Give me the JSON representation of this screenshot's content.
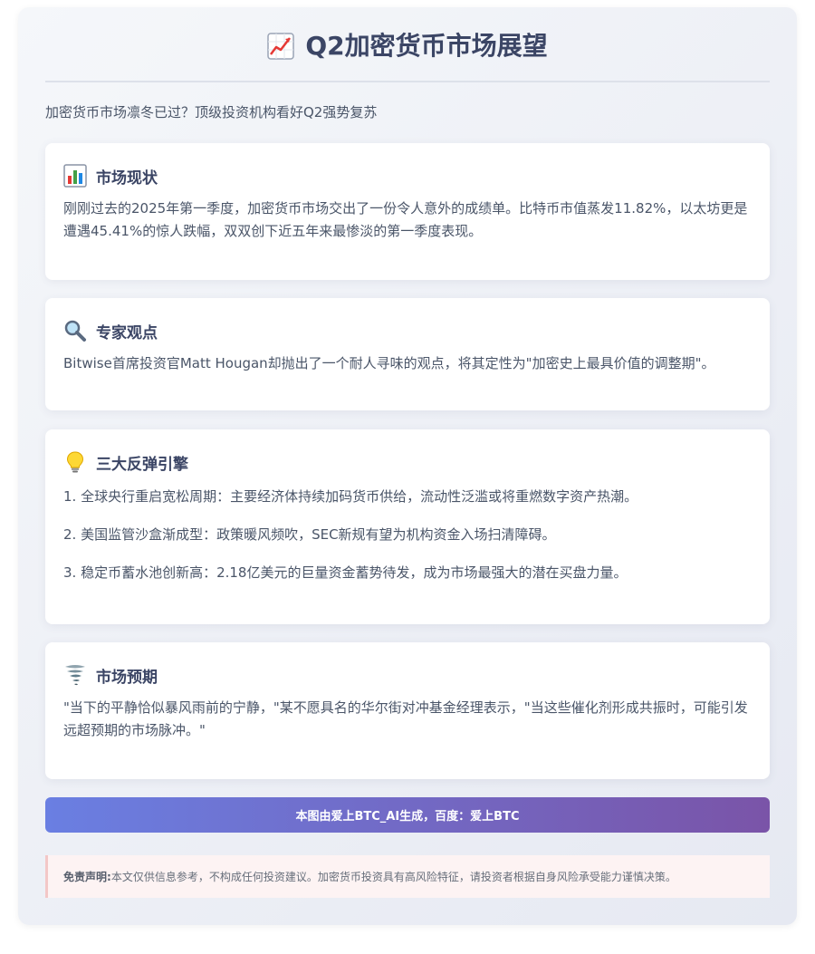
{
  "header": {
    "title": "Q2加密货币市场展望",
    "title_icon": "chart-up-icon"
  },
  "subtitle": "加密货币市场凛冬已过？顶级投资机构看好Q2强势复苏",
  "sections": [
    {
      "icon": "bar-chart-icon",
      "title": "市场现状",
      "text": "刚刚过去的2025年第一季度，加密货币市场交出了一份令人意外的成绩单。比特币市值蒸发11.82%，以太坊更是遭遇45.41%的惊人跌幅，双双创下近五年来最惨淡的第一季度表现。"
    },
    {
      "icon": "magnifier-icon",
      "title": "专家观点",
      "text": "Bitwise首席投资官Matt Hougan却抛出了一个耐人寻味的观点，将其定性为\"加密史上最具价值的调整期\"。"
    },
    {
      "icon": "lightbulb-icon",
      "title": "三大反弹引擎",
      "items": [
        "1. 全球央行重启宽松周期：主要经济体持续加码货币供给，流动性泛滥或将重燃数字资产热潮。",
        "2. 美国监管沙盒渐成型：政策暖风频吹，SEC新规有望为机构资金入场扫清障碍。",
        "3. 稳定币蓄水池创新高：2.18亿美元的巨量资金蓄势待发，成为市场最强大的潜在买盘力量。"
      ]
    },
    {
      "icon": "tornado-icon",
      "title": "市场预期",
      "text": "\"当下的平静恰似暴风雨前的宁静，\"某不愿具名的华尔街对冲基金经理表示，\"当这些催化剂形成共振时，可能引发远超预期的市场脉冲。\""
    }
  ],
  "banner": "本图由爱上BTC_AI生成，百度：爱上BTC",
  "disclaimer": {
    "label": "免责声明:",
    "text": "本文仅供信息参考，不构成任何投资建议。加密货币投资具有高风险特征，请投资者根据自身风险承受能力谨慎决策。"
  },
  "colors": {
    "title": "#3b4565",
    "banner_start": "#6a7fe2",
    "banner_end": "#7a54a8",
    "disclaimer_bg": "#fdf3f3"
  }
}
